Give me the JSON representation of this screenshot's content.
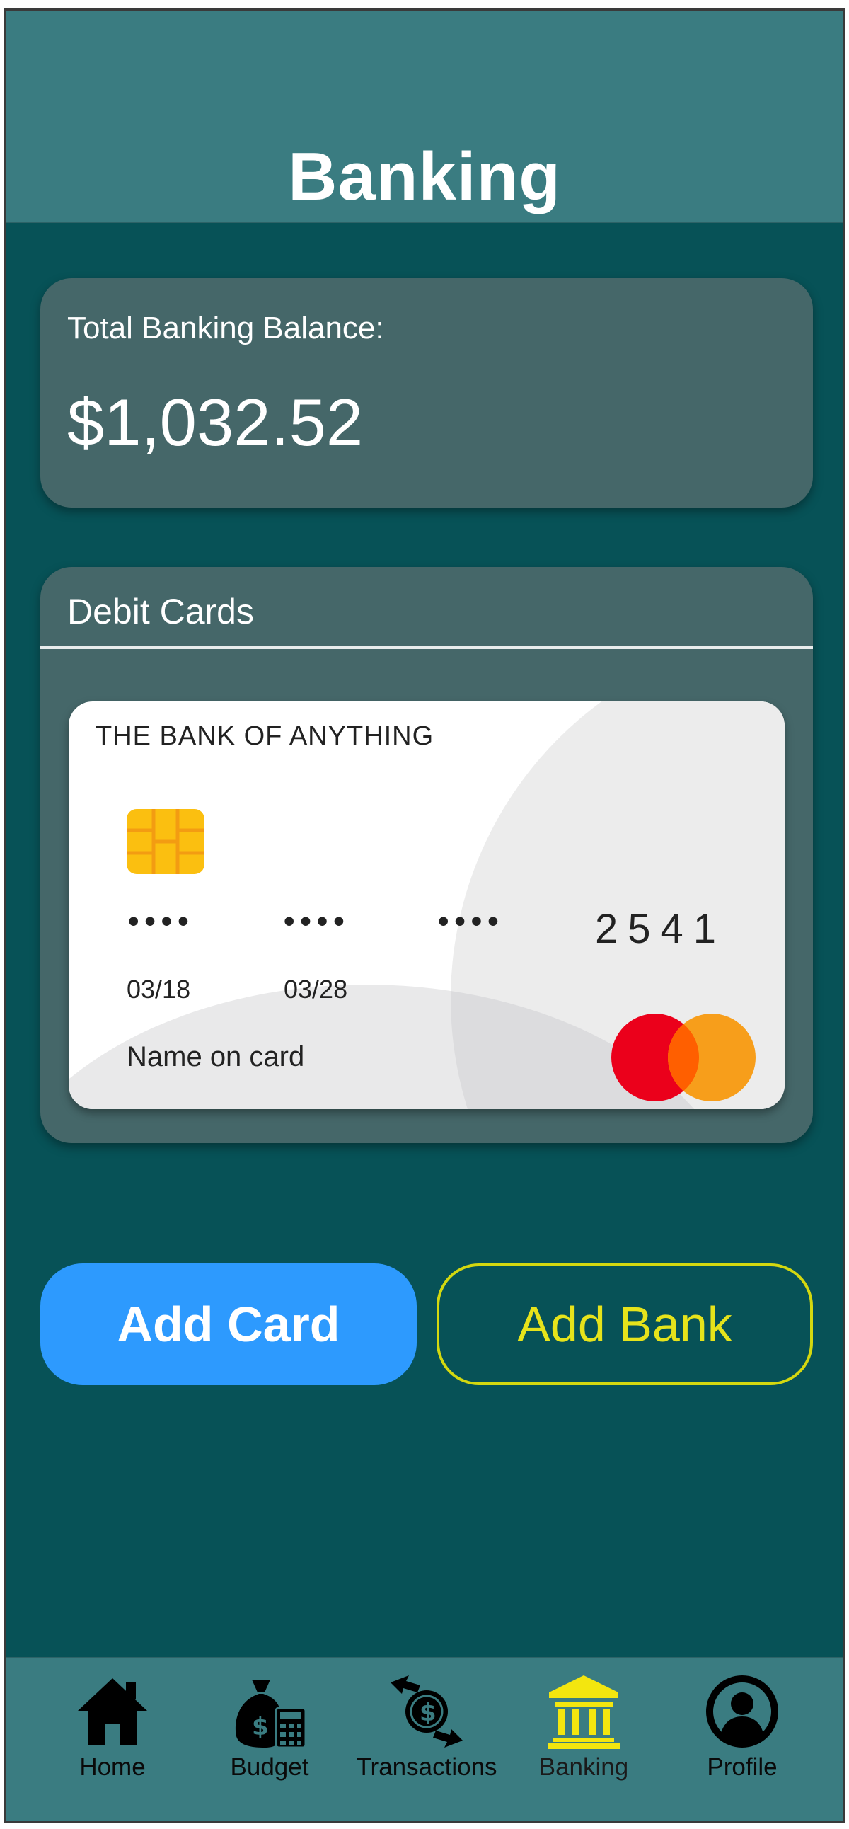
{
  "header": {
    "title": "Banking"
  },
  "balance": {
    "label": "Total Banking Balance:",
    "value": "$1,032.52"
  },
  "debit_cards": {
    "title": "Debit Cards",
    "card": {
      "bank_name": "THE BANK OF ANYTHING",
      "group1": "••••",
      "group2": "••••",
      "group3": "••••",
      "last_four": "2541",
      "valid_from": "03/18",
      "valid_thru": "03/28",
      "holder_name": "Name on card",
      "network": "mastercard-logo-icon"
    }
  },
  "actions": {
    "add_card": "Add Card",
    "add_bank": "Add Bank"
  },
  "nav": {
    "active": "Banking",
    "items": [
      {
        "label": "Home",
        "icon": "home-icon"
      },
      {
        "label": "Budget",
        "icon": "money-bag-calculator-icon"
      },
      {
        "label": "Transactions",
        "icon": "exchange-dollar-icon"
      },
      {
        "label": "Banking",
        "icon": "bank-icon"
      },
      {
        "label": "Profile",
        "icon": "profile-icon"
      }
    ]
  },
  "colors": {
    "background": "#075257",
    "header": "#3a7c81",
    "panel": "#456769",
    "primary_button": "#2d9afe",
    "accent": "#e6e31b",
    "active_nav_icon": "#f3e60f"
  }
}
